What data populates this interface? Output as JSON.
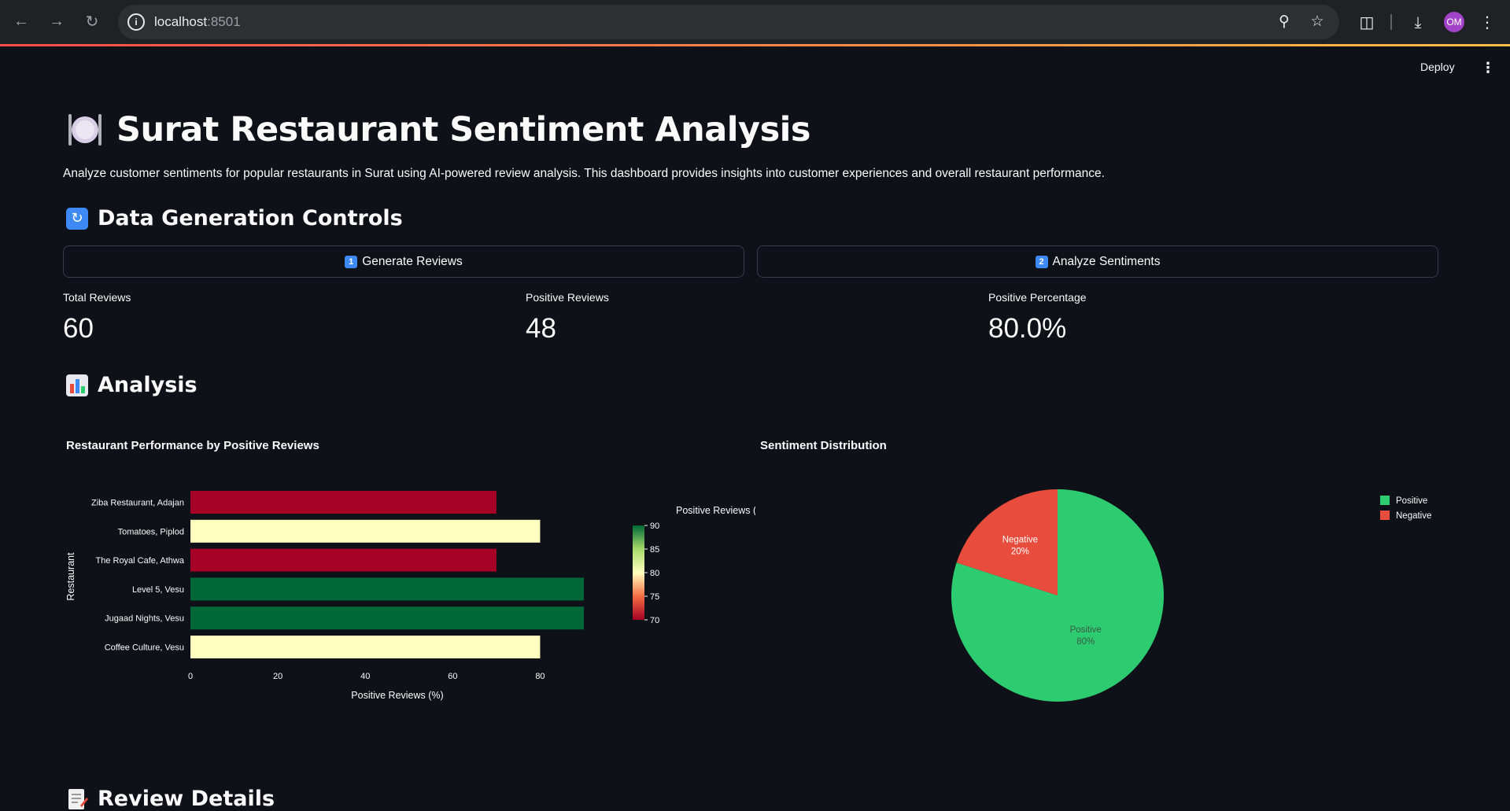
{
  "browser": {
    "url_host": "localhost",
    "url_port": ":8501",
    "profile_initials": "OM"
  },
  "app": {
    "deploy_label": "Deploy",
    "title": "Surat Restaurant Sentiment Analysis",
    "subtitle": "Analyze customer sentiments for popular restaurants in Surat using AI-powered review analysis. This dashboard provides insights into customer experiences and overall restaurant performance.",
    "section_controls": "Data Generation Controls",
    "generate_label": "Generate Reviews",
    "generate_num": "1",
    "analyze_label": "Analyze Sentiments",
    "analyze_num": "2",
    "metrics": [
      {
        "label": "Total Reviews",
        "value": "60"
      },
      {
        "label": "Positive Reviews",
        "value": "48"
      },
      {
        "label": "Positive Percentage",
        "value": "80.0%"
      }
    ],
    "section_analysis": "Analysis",
    "section_details": "Review Details"
  },
  "colors": {
    "positive": "#2ecc71",
    "negative": "#e74c3c",
    "accent": "#ff4b4b"
  },
  "chart_data": [
    {
      "type": "bar",
      "orientation": "horizontal",
      "title": "Restaurant Performance by Positive Reviews",
      "xlabel": "Positive Reviews (%)",
      "ylabel": "Restaurant",
      "categories": [
        "Ziba Restaurant, Adajan",
        "Tomatoes, Piplod",
        "The Royal Cafe, Athwa",
        "Level 5, Vesu",
        "Jugaad Nights, Vesu",
        "Coffee Culture, Vesu"
      ],
      "values": [
        70,
        80,
        70,
        90,
        90,
        80
      ],
      "xticks": [
        0,
        20,
        40,
        60,
        80
      ],
      "xlim": [
        0,
        90
      ],
      "colorbar": {
        "title": "Positive Reviews (%)",
        "ticks": [
          90,
          85,
          80,
          75,
          70
        ],
        "range": [
          70,
          90
        ],
        "colorscale": "RdYlGn"
      }
    },
    {
      "type": "pie",
      "title": "Sentiment Distribution",
      "labels": [
        "Positive",
        "Negative"
      ],
      "values": [
        80,
        20
      ],
      "slice_labels": [
        "80%",
        "20%"
      ],
      "colors": [
        "#2ecc71",
        "#e74c3c"
      ],
      "legend": "top-right"
    }
  ]
}
